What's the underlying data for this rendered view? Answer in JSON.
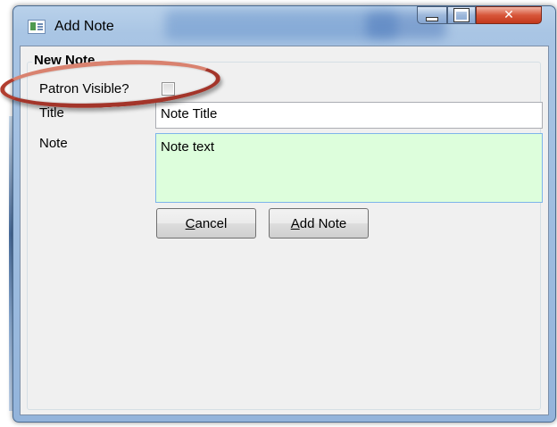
{
  "window": {
    "title": "Add Note"
  },
  "group": {
    "header": "New Note"
  },
  "form": {
    "patron_visible_label": "Patron Visible?",
    "patron_visible_checked": false,
    "title_label": "Title",
    "title_value": "Note Title",
    "note_label": "Note",
    "note_value": "Note text"
  },
  "buttons": {
    "cancel_accel": "C",
    "cancel_rest": "ancel",
    "add_accel": "A",
    "add_rest": "dd Note"
  },
  "colors": {
    "note_background": "#ddfedc",
    "highlight_ellipse": "#a3352a"
  }
}
